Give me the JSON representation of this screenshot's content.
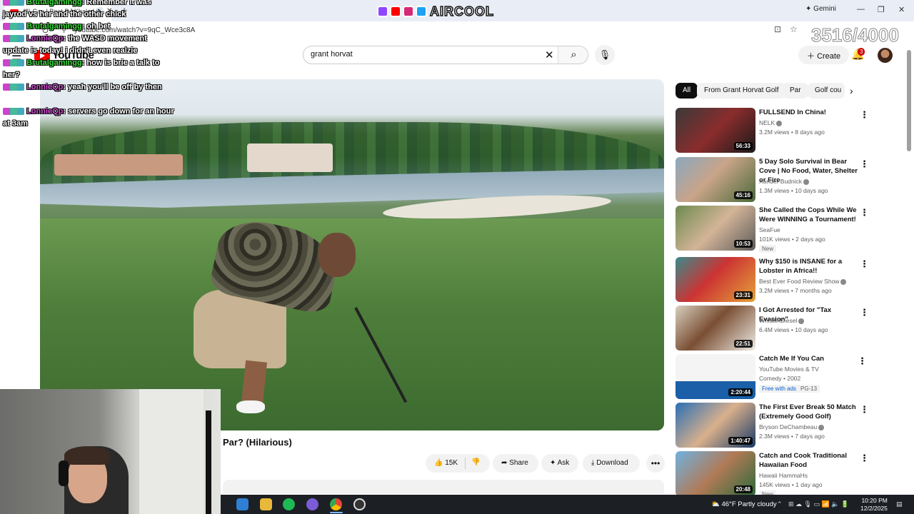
{
  "browser": {
    "tab_title": "(3) Can I Beat DJ Khaled if",
    "url": "youtube.com/watch?v=9qC_Wce3c8A",
    "gemini_label": "Gemini"
  },
  "overlay": {
    "banner_text": "AIRCOOL",
    "counter": "3516/4000",
    "chat": [
      {
        "user": "Brutalgamingg",
        "user_color": "#3ce03c",
        "text": ": Remember it was jayrod vs her and the other chick"
      },
      {
        "user": "Brutalgamingg",
        "user_color": "#3ce03c",
        "text": ": oh bet"
      },
      {
        "user": "LonnieQp",
        "user_color": "#d44fd4",
        "text": ": the WASD movement update is today! i didn't even realzie"
      },
      {
        "user": "Brutalgamingg",
        "user_color": "#3ce03c",
        "text": ": how is brie a talk to her?"
      },
      {
        "user": "LonnieQp",
        "user_color": "#d44fd4",
        "text": ": yeah you'll be off by then"
      },
      {
        "user": "LonnieQp",
        "user_color": "#d44fd4",
        "text": ": servers go down for an hour at 3am"
      }
    ]
  },
  "youtube": {
    "logo_text": "YouTube",
    "search_query": "grant horvat",
    "create_label": "Create",
    "notification_count": "3",
    "video_title": "Par? (Hilarious)",
    "like_count": "15K",
    "share_label": "Share",
    "ask_label": "Ask",
    "download_label": "Download"
  },
  "chips": [
    "All",
    "From Grant Horvat Golf",
    "Par",
    "Golf cou"
  ],
  "recommendations": [
    {
      "title": "FULLSEND In China!",
      "channel": "NELK",
      "verified": true,
      "meta": "3.2M views • 8 days ago",
      "duration": "56:33",
      "badge": ""
    },
    {
      "title": "5 Day Solo Survival in Bear Cove | No Food, Water, Shelter or Fire",
      "channel": "Xander Budnick",
      "verified": true,
      "meta": "1.3M views • 10 days ago",
      "duration": "45:16",
      "badge": ""
    },
    {
      "title": "She Called the Cops While We Were WINNING a Tournament!",
      "channel": "SeaFue",
      "verified": false,
      "meta": "101K views • 2 days ago",
      "duration": "10:53",
      "badge": "New"
    },
    {
      "title": "Why $150 is INSANE for a Lobster in Africa!!",
      "channel": "Best Ever Food Review Show",
      "verified": true,
      "meta": "3.2M views • 7 months ago",
      "duration": "23:31",
      "badge": ""
    },
    {
      "title": "I Got Arrested for \"Tax Evasion\"",
      "channel": "WhistlinDiesel",
      "verified": true,
      "meta": "6.4M views • 10 days ago",
      "duration": "22:51",
      "badge": ""
    },
    {
      "title": "Catch Me If You Can",
      "channel": "YouTube Movies & TV",
      "verified": false,
      "meta": "Comedy • 2002",
      "duration": "2:20:44",
      "badge": "Free with ads",
      "badge2": "PG-13"
    },
    {
      "title": "The First Ever Break 50 Match (Extremely Good Golf)",
      "channel": "Bryson DeChambeau",
      "verified": true,
      "meta": "2.3M views • 7 days ago",
      "duration": "1:40:47",
      "badge": ""
    },
    {
      "title": "Catch and Cook Traditional Hawaiian Food",
      "channel": "Hawaii HammaHs",
      "verified": false,
      "meta": "145K views • 1 day ago",
      "duration": "20:48",
      "badge": "New"
    }
  ],
  "taskbar": {
    "weather": "46°F  Partly cloudy",
    "time": "10:20 PM",
    "date": "12/2/2025"
  },
  "colors": {
    "yt_red": "#ff0000",
    "chip_active": "#0f0f0f",
    "taskbar": "#1c1f24"
  }
}
